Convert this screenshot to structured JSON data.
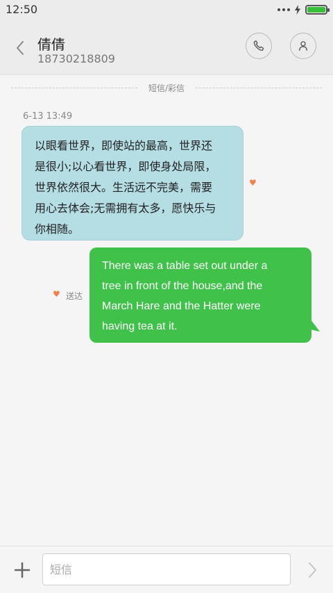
{
  "status_bar": {
    "time": "12:50",
    "battery_level": 1.0,
    "icons": [
      "signal-dots-icon",
      "charging-bolt-icon",
      "battery-icon"
    ]
  },
  "header": {
    "back_icon": "chevron-left-icon",
    "contact_name": "倩倩",
    "contact_number": "18730218809",
    "call_icon": "phone-icon",
    "contact_icon": "person-icon"
  },
  "conversation": {
    "divider_label": "短信/彩信",
    "timestamp": "6-13 13:49",
    "messages": [
      {
        "direction": "incoming",
        "lines": [
          "以眼看世界，即使站的最高，世界还",
          "是很小;以心看世界，即使身处局限，",
          "世界依然很大。生活远不完美，需要",
          "用心去体会;无需拥有太多，愿快乐与",
          "你相随。"
        ],
        "color": "#b5dde4"
      },
      {
        "direction": "outgoing",
        "lines": [
          "There was a table set out under a",
          "tree in front of the house,and the",
          "March Hare and the Hatter were",
          "having tea at it."
        ],
        "status": "送达",
        "color": "#3fc14a"
      }
    ],
    "heart_icon_color": "#f3804a"
  },
  "composer": {
    "placeholder": "短信",
    "value": "",
    "add_icon": "plus-icon",
    "send_icon": "chevron-right-icon"
  }
}
